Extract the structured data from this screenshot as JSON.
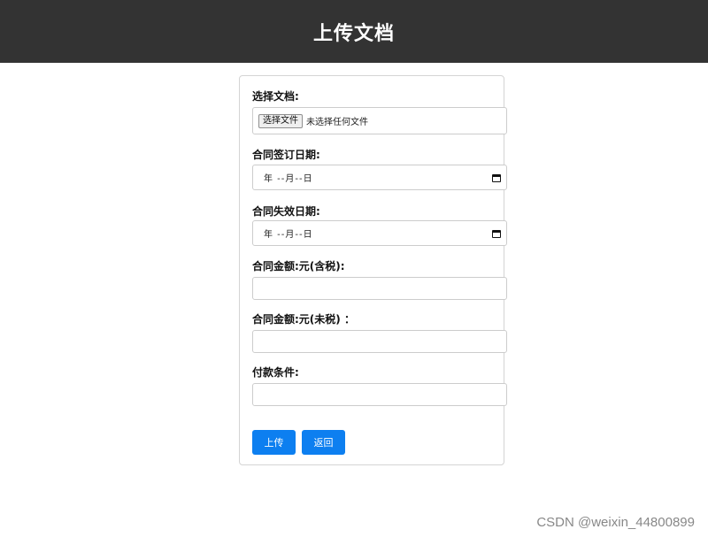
{
  "header": {
    "title": "上传文档"
  },
  "form": {
    "file": {
      "label": "选择文档:",
      "button_label": "选择文件",
      "status": "未选择任何文件"
    },
    "sign_date": {
      "label": "合同签订日期:",
      "value": "年 --月--日",
      "icon": "calendar-icon"
    },
    "expire_date": {
      "label": "合同失效日期:",
      "value": "年 --月--日",
      "icon": "calendar-icon"
    },
    "amount_tax": {
      "label": "合同金额:元(含税):",
      "value": ""
    },
    "amount_notax": {
      "label": "合同金额:元(未税) ：",
      "value": ""
    },
    "payment_terms": {
      "label": "付款条件:",
      "value": ""
    },
    "buttons": {
      "upload": "上传",
      "back": "返回"
    }
  },
  "colors": {
    "header_bg": "#333333",
    "primary_button": "#0d7ff0"
  },
  "watermark": "CSDN @weixin_44800899"
}
